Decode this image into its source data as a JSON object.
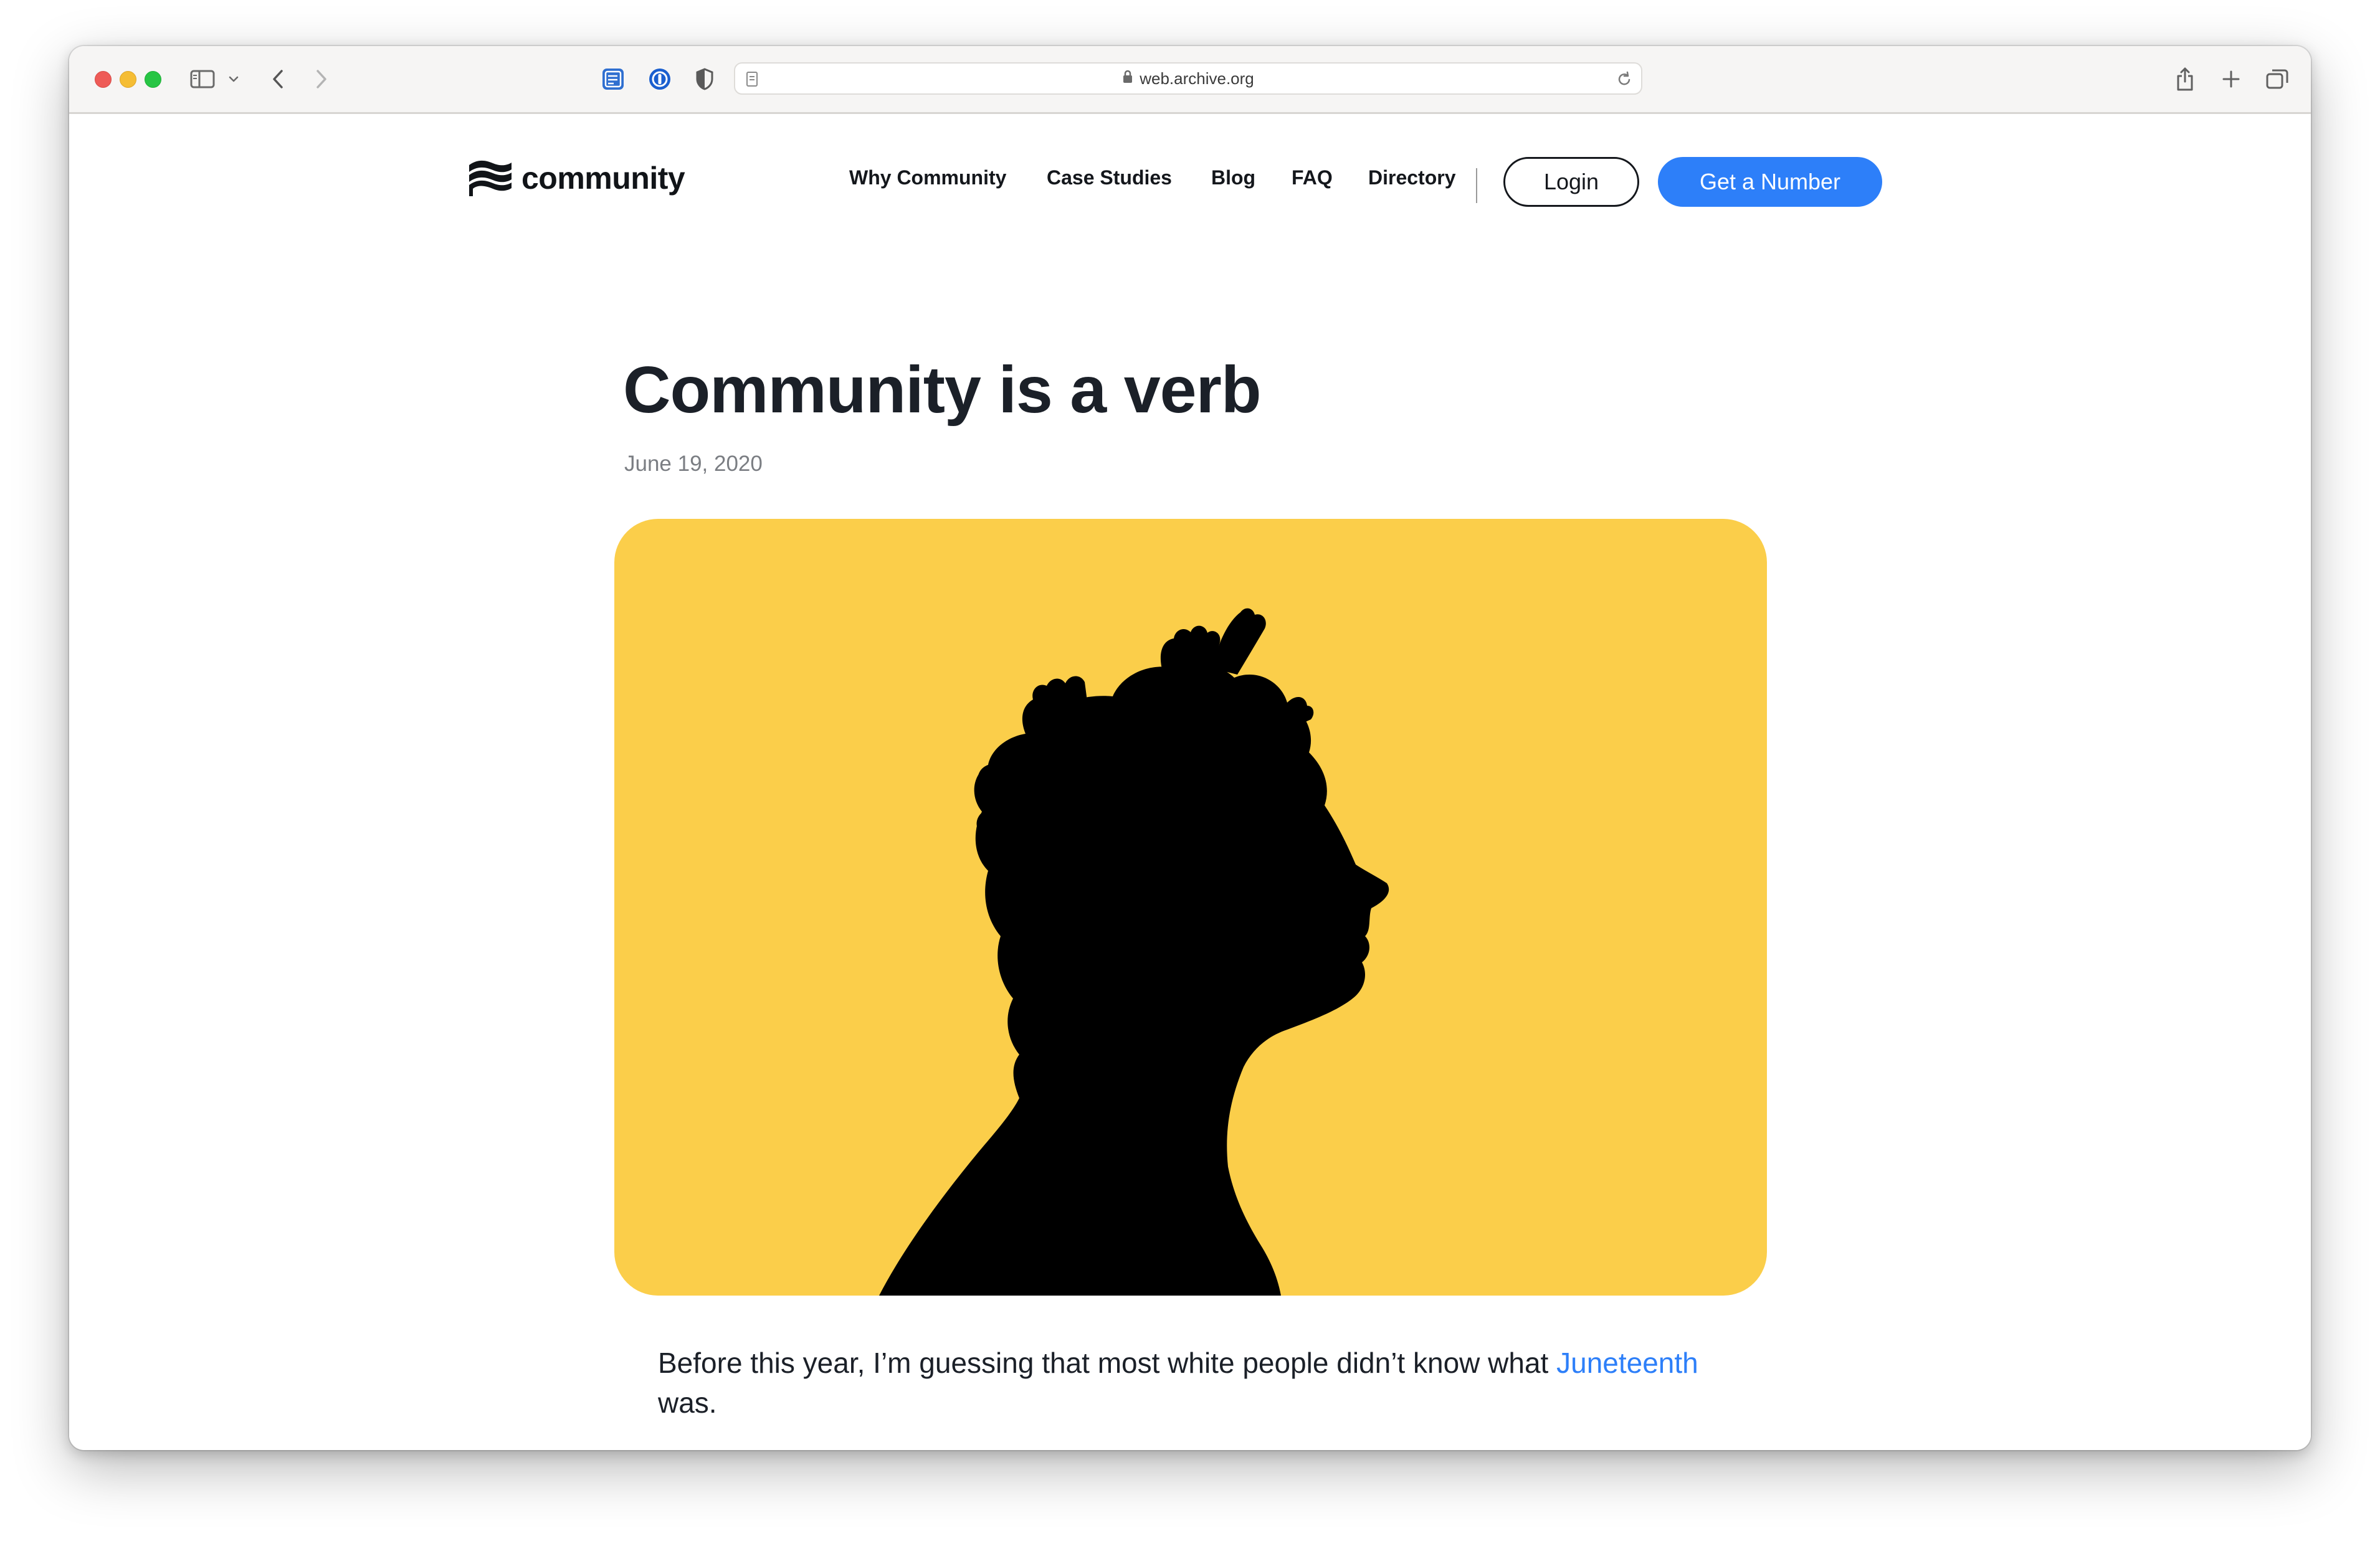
{
  "browser": {
    "url": "web.archive.org",
    "icons": [
      "sidebar-icon",
      "chevron-down-icon",
      "back-arrow-icon",
      "forward-arrow-icon",
      "notes-extension-icon",
      "password-extension-icon",
      "shield-extension-icon",
      "page-icon",
      "lock-icon",
      "reload-icon",
      "share-icon",
      "new-tab-icon",
      "tabs-overview-icon"
    ]
  },
  "site": {
    "logo_text": "community",
    "nav": [
      "Why Community",
      "Case Studies",
      "Blog",
      "FAQ",
      "Directory"
    ],
    "login_label": "Login",
    "cta_label": "Get a Number",
    "accent_color": "#2d7ff9"
  },
  "post": {
    "title": "Community is a verb",
    "date": "June 19, 2020",
    "hero_background": "#fbce4a",
    "body_before": "Before this year, I’m guessing that most white people didn’t know what ",
    "body_link": "Juneteenth",
    "body_after": " was."
  }
}
